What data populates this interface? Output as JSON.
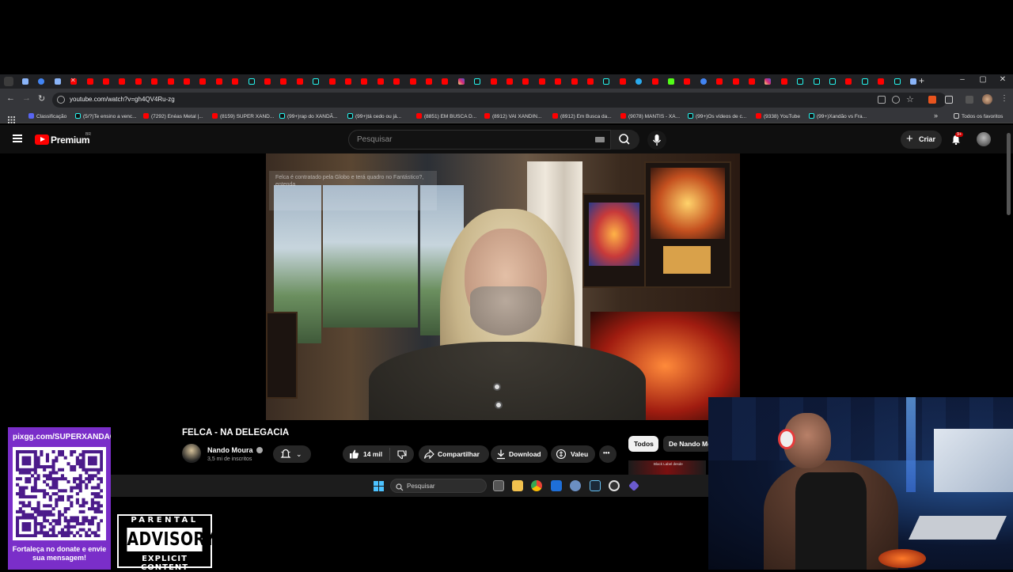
{
  "browser": {
    "url": "youtube.com/watch?v=gh4QV4Ru-zg",
    "window_controls": {
      "minimize": "–",
      "maximize": "▢",
      "close": "✕"
    },
    "new_tab": "+",
    "bookmarks": [
      {
        "label": "Classificação",
        "icon": "discord-icon"
      },
      {
        "label": "(5/?)Te ensino a venc...",
        "icon": "tiktok-icon"
      },
      {
        "label": "(7292) Enéas Metal |...",
        "icon": "youtube-icon"
      },
      {
        "label": "(8159) SUPER XAND...",
        "icon": "youtube-icon"
      },
      {
        "label": "(99+)rap do XANDÃ...",
        "icon": "tiktok-icon"
      },
      {
        "label": "(99+)tá cedo ou já...",
        "icon": "tiktok-icon"
      },
      {
        "label": "(8851) EM BUSCA D...",
        "icon": "youtube-icon"
      },
      {
        "label": "(8912) VAI XANDIN...",
        "icon": "youtube-icon"
      },
      {
        "label": "(8912) Em Busca da...",
        "icon": "youtube-icon"
      },
      {
        "label": "(9078) MANTIS - XA...",
        "icon": "youtube-icon"
      },
      {
        "label": "(99+)Os vídeos de c...",
        "icon": "tiktok-icon"
      },
      {
        "label": "(9338) YouTube",
        "icon": "youtube-icon"
      },
      {
        "label": "(99+)Xandão vs Fra...",
        "icon": "tiktok-icon"
      }
    ],
    "bookmarks_more": "»",
    "all_bookmarks": "Todos os favoritos"
  },
  "youtube": {
    "brand": "Premium",
    "region": "BR",
    "search_placeholder": "Pesquisar",
    "create_label": "Criar",
    "notifications_badge": "9+",
    "video": {
      "overlay_text": "Felca é contratado pela Globo e terá quadro no Fantástico?, entenda",
      "title": "FELCA - NA DELEGACIA",
      "channel": "Nando Moura",
      "subscribers": "3,5 mi de inscritos",
      "likes": "14 mil",
      "share_label": "Compartilhar",
      "download_label": "Download",
      "thanks_label": "Valeu",
      "more_label": "•••"
    },
    "chips": [
      "Todos",
      "De Nando Moura"
    ],
    "recommended_thumb_text": "Black Label desde"
  },
  "taskbar": {
    "search_placeholder": "Pesquisar"
  },
  "stream_overlay": {
    "donate_url": "pixgg.com/SUPERXANDAO",
    "donate_message": "Fortaleça no donate e envie sua mensagem!",
    "parental_advisory": {
      "top": "PARENTAL",
      "middle": "ADVISORY",
      "bottom": "EXPLICIT CONTENT"
    }
  },
  "colors": {
    "youtube_red": "#ff0000",
    "donate_purple": "#7a2ec9",
    "chrome_dark": "#202124",
    "youtube_bg": "#0f0f0f"
  }
}
